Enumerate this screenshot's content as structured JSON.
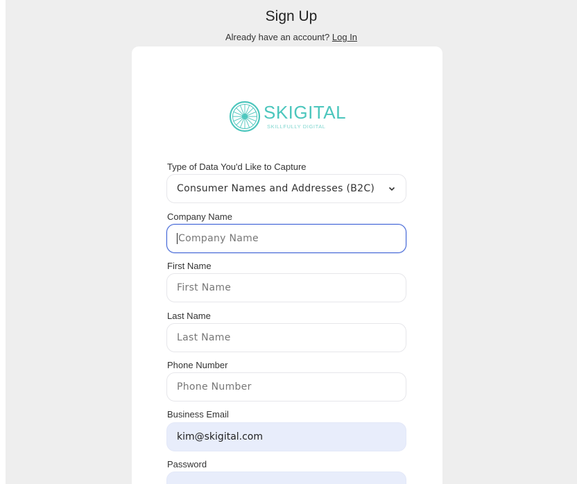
{
  "header": {
    "title": "Sign Up",
    "account_prompt": "Already have an account?",
    "login_link": "Log In"
  },
  "logo": {
    "wordmark": "SKIGITAL",
    "tagline": "SKILLFULLY DIGITAL",
    "color": "#4cc6bd",
    "icon": "bicycle-wheel-icon"
  },
  "form": {
    "data_type": {
      "label": "Type of Data You'd Like to Capture",
      "selected": "Consumer Names and Addresses (B2C)"
    },
    "company_name": {
      "label": "Company Name",
      "placeholder": "Company Name"
    },
    "first_name": {
      "label": "First Name",
      "placeholder": "First Name"
    },
    "last_name": {
      "label": "Last Name",
      "placeholder": "Last Name"
    },
    "phone": {
      "label": "Phone Number",
      "placeholder": "Phone Number"
    },
    "email": {
      "label": "Business Email",
      "value": "kim@skigital.com"
    },
    "password": {
      "label": "Password"
    }
  },
  "colors": {
    "focus_border": "#3f63d6",
    "autofill_bg": "#e8edfb",
    "page_bg": "#eeeeee"
  }
}
